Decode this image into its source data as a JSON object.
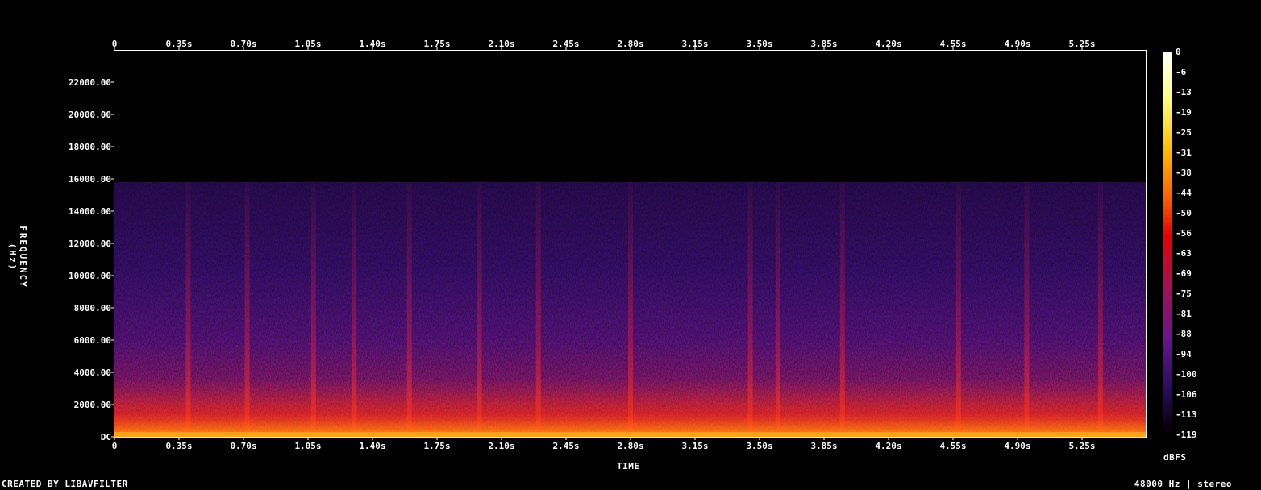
{
  "chart_data": {
    "type": "heatmap",
    "xlabel": "TIME",
    "ylabel": "FREQUENCY (Hz)",
    "x_ticks": [
      "0",
      "0.35s",
      "0.70s",
      "1.05s",
      "1.40s",
      "1.75s",
      "2.10s",
      "2.45s",
      "2.80s",
      "3.15s",
      "3.50s",
      "3.85s",
      "4.20s",
      "4.55s",
      "4.90s",
      "5.25s"
    ],
    "x_tick_values": [
      0,
      0.35,
      0.7,
      1.05,
      1.4,
      1.75,
      2.1,
      2.45,
      2.8,
      3.15,
      3.5,
      3.85,
      4.2,
      4.55,
      4.9,
      5.25
    ],
    "xlim": [
      0,
      5.6
    ],
    "y_ticks": [
      "DC",
      "2000.00",
      "4000.00",
      "6000.00",
      "8000.00",
      "10000.00",
      "12000.00",
      "14000.00",
      "16000.00",
      "18000.00",
      "20000.00",
      "22000.00"
    ],
    "y_tick_values": [
      0,
      2000,
      4000,
      6000,
      8000,
      10000,
      12000,
      14000,
      16000,
      18000,
      20000,
      22000
    ],
    "ylim": [
      0,
      24000
    ],
    "content_cutoff_hz": 15800,
    "colorbar": {
      "label": "dBFS",
      "ticks": [
        "0",
        "-6",
        "-13",
        "-19",
        "-25",
        "-31",
        "-38",
        "-44",
        "-50",
        "-56",
        "-63",
        "-69",
        "-75",
        "-81",
        "-88",
        "-94",
        "-100",
        "-106",
        "-113",
        "-119"
      ],
      "range": [
        0,
        -119
      ]
    }
  },
  "footer": {
    "credit": "CREATED BY LIBAVFILTER",
    "info": "48000 Hz | stereo"
  }
}
